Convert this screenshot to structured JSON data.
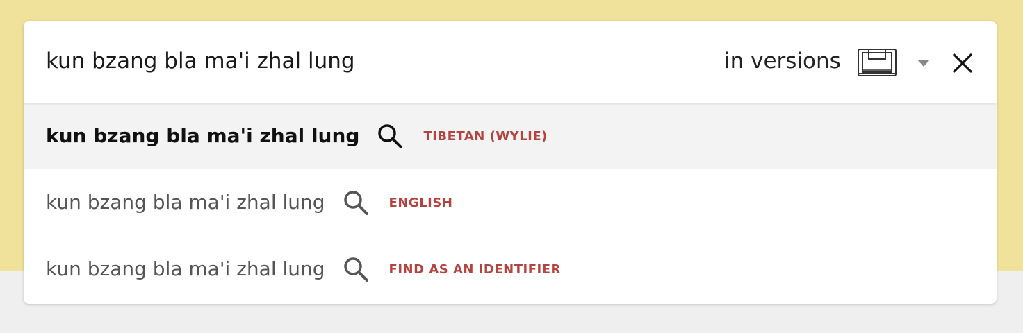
{
  "search": {
    "query": "kun bzang bla ma'i zhal lung",
    "scope_label": "in versions",
    "scope_icon": "book-icon",
    "dropdown_icon": "chevron-down-icon",
    "close_icon": "close-icon"
  },
  "suggestions": [
    {
      "text": "kun bzang bla ma'i zhal lung",
      "type": "TIBETAN (WYLIE)",
      "icon": "search-icon",
      "active": true
    },
    {
      "text": "kun bzang bla ma'i zhal lung",
      "type": "ENGLISH",
      "icon": "search-icon",
      "active": false
    },
    {
      "text": "kun bzang bla ma'i zhal lung",
      "type": "FIND AS AN IDENTIFIER",
      "icon": "search-icon",
      "active": false
    }
  ],
  "colors": {
    "background_band": "#f0e29a",
    "type_label": "#b3433f",
    "active_row": "#f3f3f3"
  }
}
